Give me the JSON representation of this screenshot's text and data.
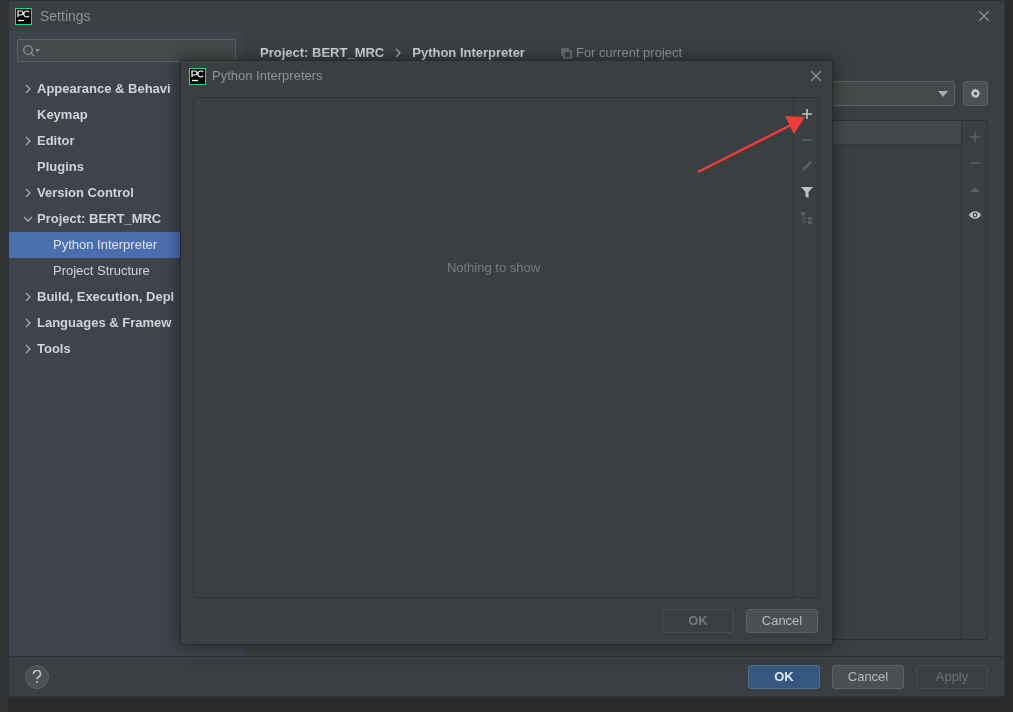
{
  "settings_window": {
    "title": "Settings",
    "sidebar": [
      {
        "label": "Appearance & Behavi",
        "kind": "group",
        "expanded": false,
        "selected": false
      },
      {
        "label": "Keymap",
        "kind": "leaf",
        "selected": false
      },
      {
        "label": "Editor",
        "kind": "group",
        "expanded": false,
        "selected": false
      },
      {
        "label": "Plugins",
        "kind": "leaf",
        "selected": false
      },
      {
        "label": "Version Control",
        "kind": "group",
        "expanded": false,
        "selected": false
      },
      {
        "label": "Project: BERT_MRC",
        "kind": "group",
        "expanded": true,
        "selected": false,
        "children": [
          {
            "label": "Python Interpreter",
            "selected": true
          },
          {
            "label": "Project Structure",
            "selected": false
          }
        ]
      },
      {
        "label": "Build, Execution, Depl",
        "kind": "group",
        "expanded": false,
        "selected": false
      },
      {
        "label": "Languages & Framew",
        "kind": "group",
        "expanded": false,
        "selected": false
      },
      {
        "label": "Tools",
        "kind": "group",
        "expanded": false,
        "selected": false
      }
    ],
    "breadcrumb": [
      "Project: BERT_MRC",
      "Python Interpreter"
    ],
    "scope_note": "For current project",
    "package_toolbar": [
      {
        "kind": "plus",
        "disabled": true
      },
      {
        "kind": "minus",
        "disabled": true
      },
      {
        "kind": "up",
        "disabled": true
      },
      {
        "kind": "eye",
        "disabled": false
      }
    ],
    "buttons": [
      {
        "label": "OK",
        "primary": true,
        "disabled": false
      },
      {
        "label": "Cancel",
        "primary": false,
        "disabled": false
      },
      {
        "label": "Apply",
        "primary": false,
        "disabled": true
      }
    ]
  },
  "dialog": {
    "title": "Python Interpreters",
    "empty_text": "Nothing to show",
    "toolbar": [
      {
        "kind": "plus",
        "disabled": false
      },
      {
        "kind": "minus",
        "disabled": true
      },
      {
        "kind": "edit",
        "disabled": true
      },
      {
        "kind": "filter",
        "disabled": false
      },
      {
        "kind": "tree",
        "disabled": true
      }
    ],
    "buttons": [
      {
        "label": "OK",
        "disabled": true
      },
      {
        "label": "Cancel",
        "disabled": false
      }
    ]
  }
}
